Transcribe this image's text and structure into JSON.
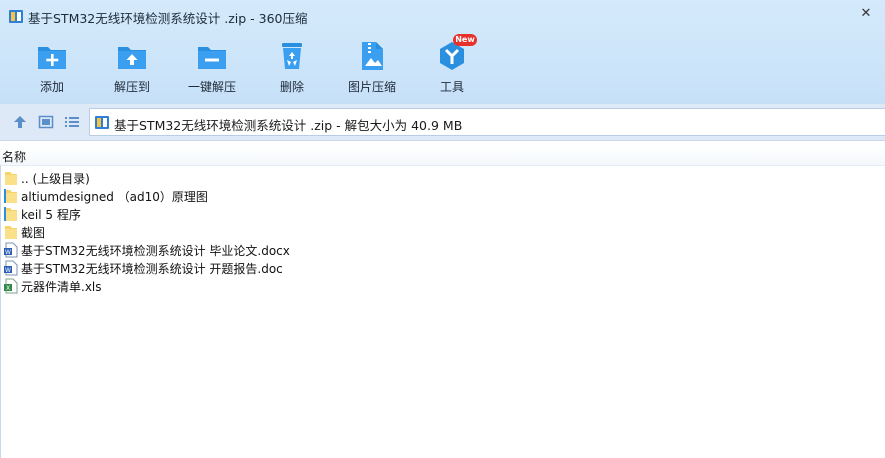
{
  "window": {
    "title": "基于STM32无线环境检测系统设计 .zip - 360压缩",
    "close_glyph": "✕"
  },
  "toolbar": {
    "buttons": [
      {
        "label": "添加",
        "icon": "add-file-icon"
      },
      {
        "label": "解压到",
        "icon": "extract-to-icon"
      },
      {
        "label": "一键解压",
        "icon": "one-click-extract-icon"
      },
      {
        "label": "删除",
        "icon": "recycle-bin-icon"
      },
      {
        "label": "图片压缩",
        "icon": "image-compress-icon"
      },
      {
        "label": "工具",
        "icon": "tools-icon",
        "badge": "New"
      }
    ]
  },
  "address": {
    "text": "基于STM32无线环境检测系统设计 .zip - 解包大小为 40.9 MB"
  },
  "list": {
    "column_name": "名称",
    "rows": [
      {
        "name": ".. (上级目录)",
        "type": "folder"
      },
      {
        "name": "altiumdesigned  （ad10）原理图",
        "type": "folder-partial"
      },
      {
        "name": "keil 5 程序",
        "type": "folder-partial"
      },
      {
        "name": "截图",
        "type": "folder"
      },
      {
        "name": "基于STM32无线环境检测系统设计 毕业论文.docx",
        "type": "word"
      },
      {
        "name": "基于STM32无线环境检测系统设计 开题报告.doc",
        "type": "word"
      },
      {
        "name": "元器件清单.xls",
        "type": "excel"
      }
    ]
  },
  "colors": {
    "accent_blue": "#2b8fe0",
    "folder_yellow": "#f7d36a",
    "badge_red": "#e8302b",
    "toolbar_bg": "#cde5fa"
  }
}
